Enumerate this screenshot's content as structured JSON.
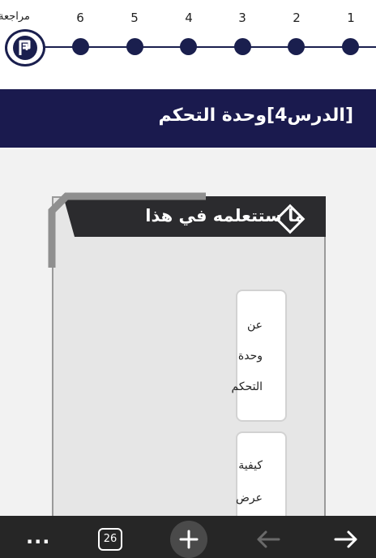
{
  "stepper": {
    "steps": [
      "1",
      "2",
      "3",
      "4",
      "5",
      "6"
    ],
    "review_label": "مراجعة"
  },
  "lesson": {
    "title": "[الدرس4]وحدة التحكم"
  },
  "card": {
    "title": "ما ستتعلمه في هذا",
    "items": [
      {
        "lines": [
          "عن",
          "وحدة",
          "التحكم"
        ]
      },
      {
        "lines": [
          "كيفية",
          "عرض"
        ]
      }
    ]
  },
  "toolbar": {
    "more": "...",
    "tab_count": "26"
  },
  "colors": {
    "navy": "#1a1f4e",
    "header_bg": "#1a1a4e",
    "card_head_bg": "#2b2b2e",
    "toolbar_bg": "#262626"
  }
}
